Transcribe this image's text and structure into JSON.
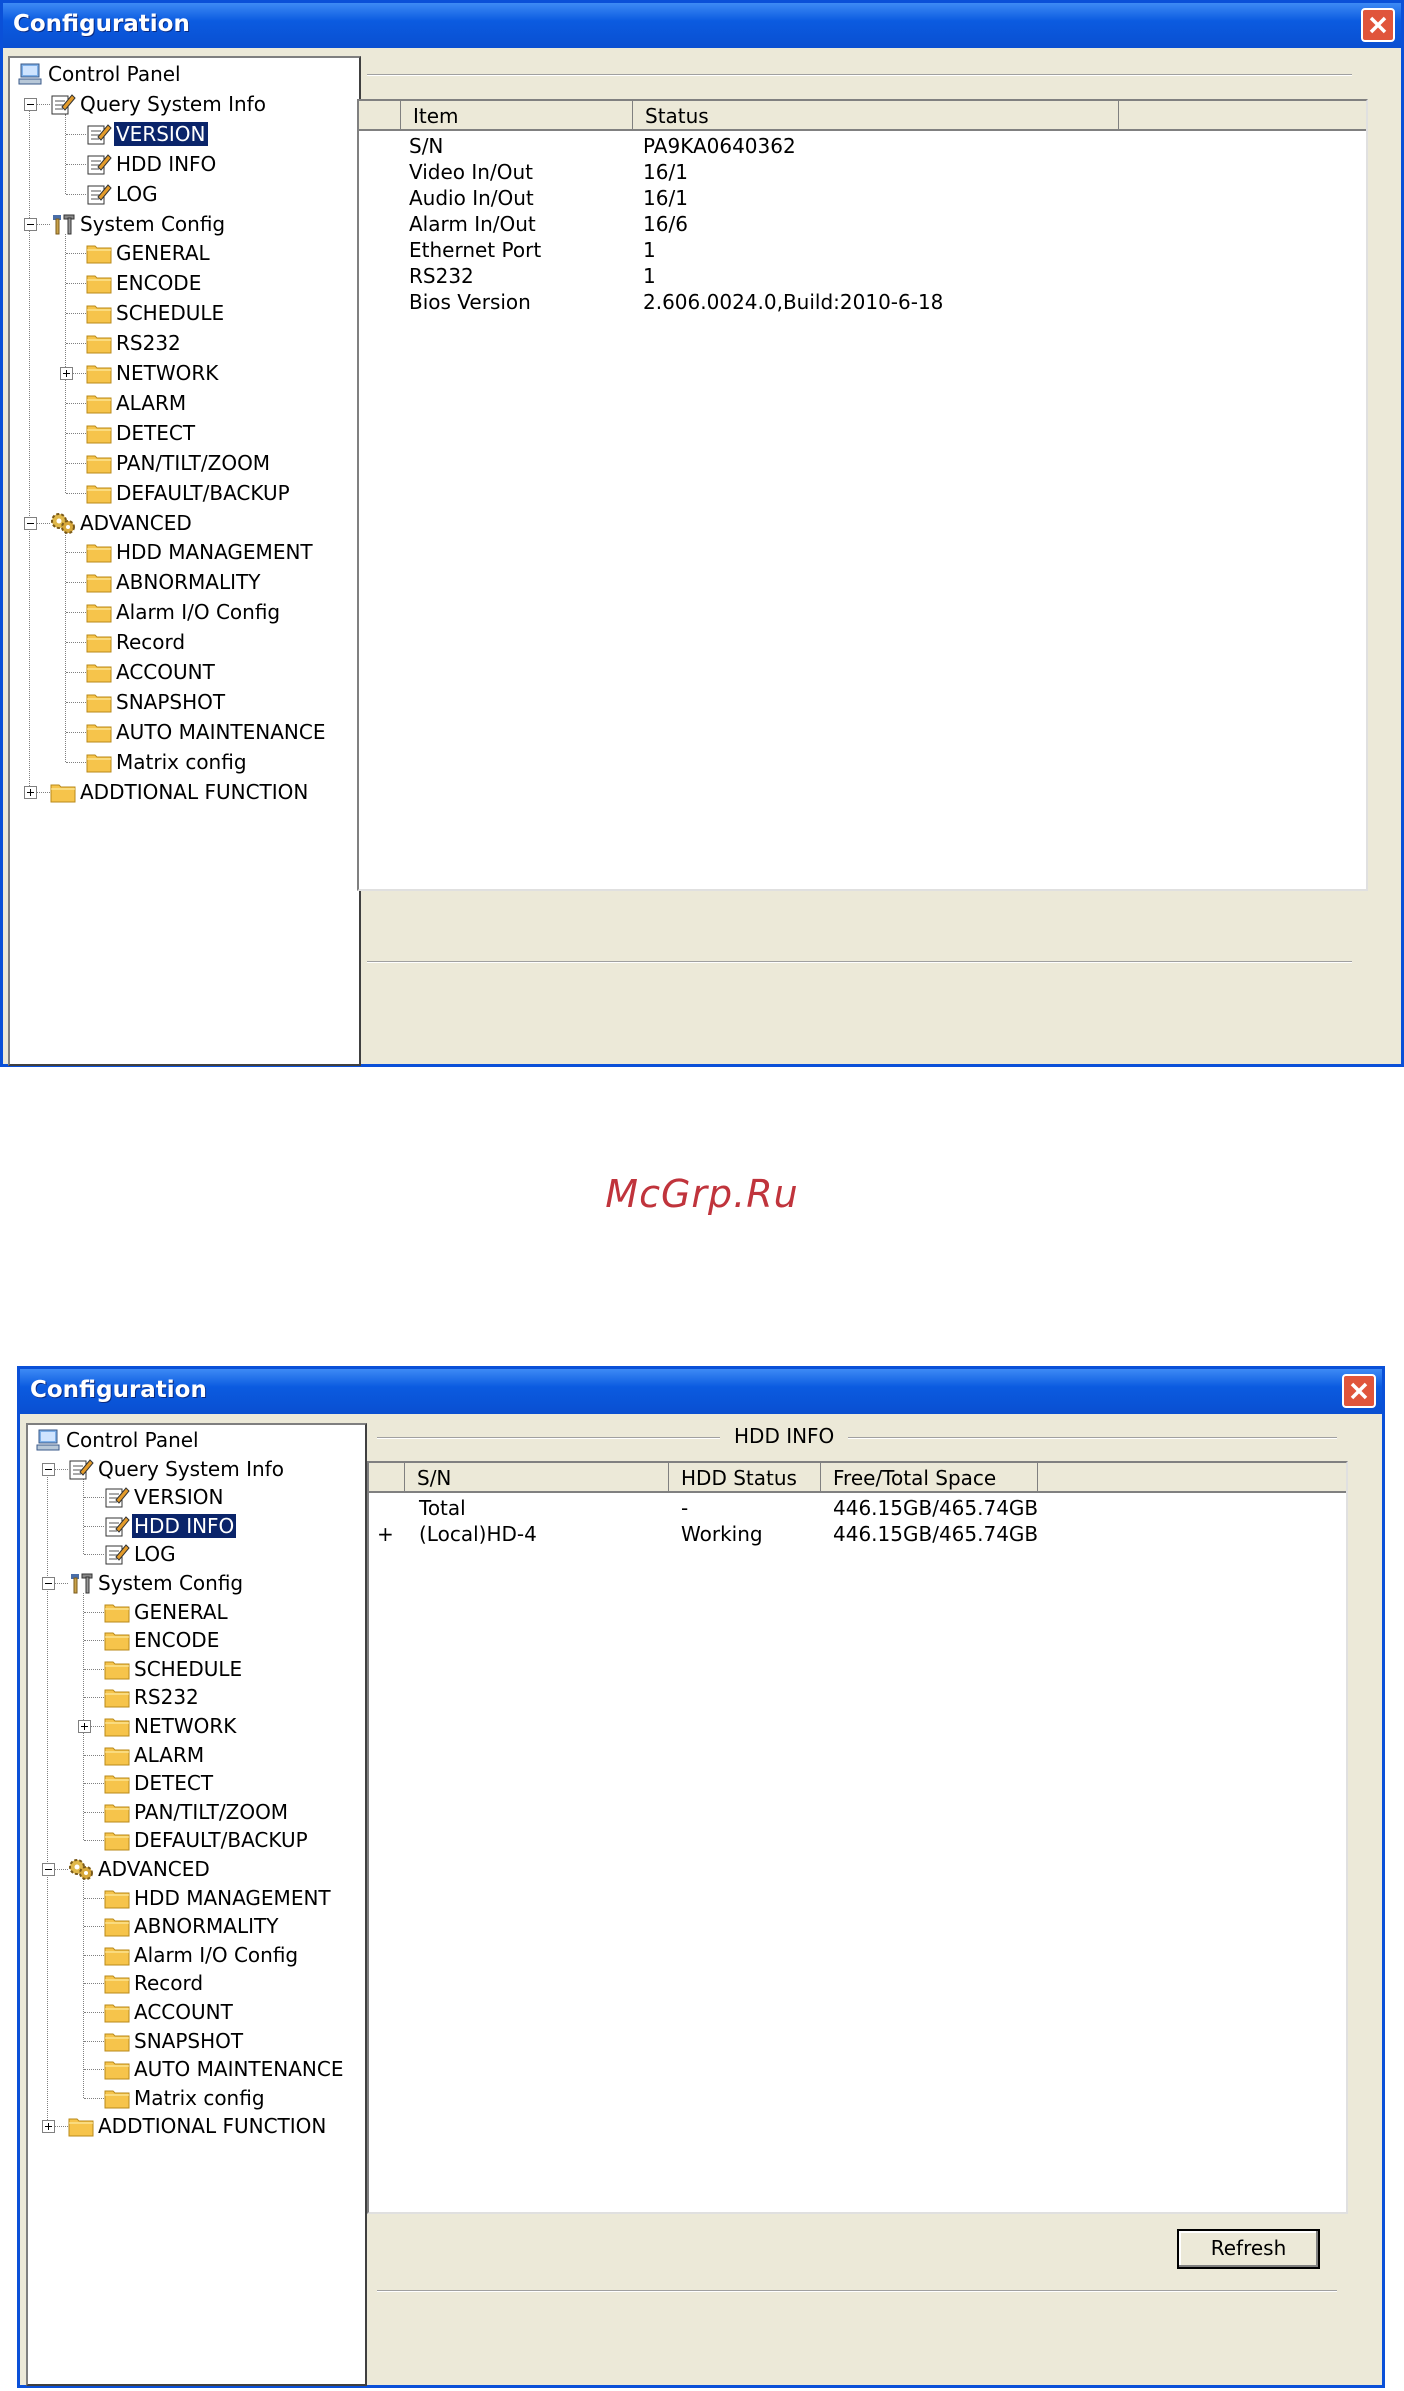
{
  "window1": {
    "title": "Configuration",
    "tree": [
      {
        "label": "Control Panel",
        "icon": "monitor-icon"
      },
      {
        "label": "Query System Info",
        "icon": "notepad-icon"
      },
      {
        "label": "VERSION",
        "icon": "notepad-icon",
        "selected": true
      },
      {
        "label": "HDD INFO",
        "icon": "notepad-icon"
      },
      {
        "label": "LOG",
        "icon": "notepad-icon"
      },
      {
        "label": "System Config",
        "icon": "tools-icon"
      },
      {
        "label": "GENERAL",
        "icon": "folder-icon"
      },
      {
        "label": "ENCODE",
        "icon": "folder-icon"
      },
      {
        "label": "SCHEDULE",
        "icon": "folder-icon"
      },
      {
        "label": "RS232",
        "icon": "folder-icon"
      },
      {
        "label": "NETWORK",
        "icon": "folder-icon"
      },
      {
        "label": "ALARM",
        "icon": "folder-icon"
      },
      {
        "label": "DETECT",
        "icon": "folder-icon"
      },
      {
        "label": "PAN/TILT/ZOOM",
        "icon": "folder-icon"
      },
      {
        "label": "DEFAULT/BACKUP",
        "icon": "folder-icon"
      },
      {
        "label": "ADVANCED",
        "icon": "gears-icon"
      },
      {
        "label": "HDD MANAGEMENT",
        "icon": "folder-icon"
      },
      {
        "label": "ABNORMALITY",
        "icon": "folder-icon"
      },
      {
        "label": "Alarm I/O Config",
        "icon": "folder-icon"
      },
      {
        "label": "Record",
        "icon": "folder-icon"
      },
      {
        "label": "ACCOUNT",
        "icon": "folder-icon"
      },
      {
        "label": "SNAPSHOT",
        "icon": "folder-icon"
      },
      {
        "label": "AUTO MAINTENANCE",
        "icon": "folder-icon"
      },
      {
        "label": "Matrix config",
        "icon": "folder-icon"
      },
      {
        "label": "ADDTIONAL FUNCTION",
        "icon": "folder-icon"
      }
    ],
    "columns": [
      "Item",
      "Status"
    ],
    "rows": [
      [
        "S/N",
        "PA9KA0640362"
      ],
      [
        "Video In/Out",
        "16/1"
      ],
      [
        "Audio In/Out",
        "16/1"
      ],
      [
        "Alarm In/Out",
        "16/6"
      ],
      [
        "Ethernet Port",
        "1"
      ],
      [
        "RS232",
        "1"
      ],
      [
        "Bios Version",
        "2.606.0024.0,Build:2010-6-18"
      ]
    ]
  },
  "watermark": "McGrp.Ru",
  "window2": {
    "title": "Configuration",
    "group_title": "HDD INFO",
    "tree": [
      {
        "label": "Control Panel",
        "icon": "monitor-icon"
      },
      {
        "label": "Query System Info",
        "icon": "notepad-icon"
      },
      {
        "label": "VERSION",
        "icon": "notepad-icon"
      },
      {
        "label": "HDD INFO",
        "icon": "notepad-icon",
        "selected": true
      },
      {
        "label": "LOG",
        "icon": "notepad-icon"
      },
      {
        "label": "System Config",
        "icon": "tools-icon"
      },
      {
        "label": "GENERAL",
        "icon": "folder-icon"
      },
      {
        "label": "ENCODE",
        "icon": "folder-icon"
      },
      {
        "label": "SCHEDULE",
        "icon": "folder-icon"
      },
      {
        "label": "RS232",
        "icon": "folder-icon"
      },
      {
        "label": "NETWORK",
        "icon": "folder-icon"
      },
      {
        "label": "ALARM",
        "icon": "folder-icon"
      },
      {
        "label": "DETECT",
        "icon": "folder-icon"
      },
      {
        "label": "PAN/TILT/ZOOM",
        "icon": "folder-icon"
      },
      {
        "label": "DEFAULT/BACKUP",
        "icon": "folder-icon"
      },
      {
        "label": "ADVANCED",
        "icon": "gears-icon"
      },
      {
        "label": "HDD MANAGEMENT",
        "icon": "folder-icon"
      },
      {
        "label": "ABNORMALITY",
        "icon": "folder-icon"
      },
      {
        "label": "Alarm I/O Config",
        "icon": "folder-icon"
      },
      {
        "label": "Record",
        "icon": "folder-icon"
      },
      {
        "label": "ACCOUNT",
        "icon": "folder-icon"
      },
      {
        "label": "SNAPSHOT",
        "icon": "folder-icon"
      },
      {
        "label": "AUTO MAINTENANCE",
        "icon": "folder-icon"
      },
      {
        "label": "Matrix config",
        "icon": "folder-icon"
      },
      {
        "label": "ADDTIONAL FUNCTION",
        "icon": "folder-icon"
      }
    ],
    "columns": [
      "S/N",
      "HDD Status",
      "Free/Total Space"
    ],
    "rows": [
      {
        "expander": "",
        "sn": "Total",
        "status": "-",
        "space": "446.15GB/465.74GB"
      },
      {
        "expander": "+",
        "sn": "(Local)HD-4",
        "status": "Working",
        "space": "446.15GB/465.74GB"
      }
    ],
    "refresh_label": "Refresh"
  },
  "colors": {
    "titlebar": "#0a4fd1",
    "selection": "#0a246a",
    "watermark": "#c0343c",
    "window_bg": "#ece9d8"
  }
}
